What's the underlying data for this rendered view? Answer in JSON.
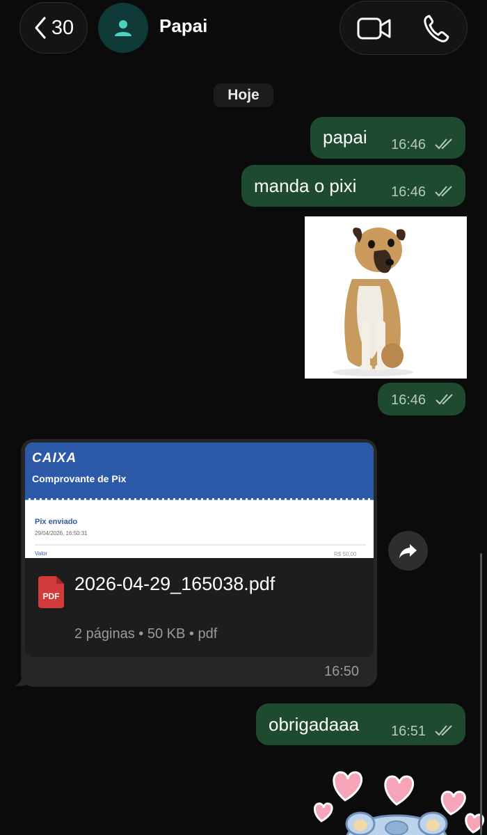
{
  "header": {
    "back_count": "30",
    "contact_name": "Papai",
    "video_call_icon": "video-camera-icon",
    "voice_call_icon": "phone-icon",
    "avatar_icon": "person-icon"
  },
  "date_separator": "Hoje",
  "messages": [
    {
      "type": "outgoing-text",
      "text": "papai",
      "time": "16:46",
      "status": "read"
    },
    {
      "type": "outgoing-text",
      "text": "manda o pixi",
      "time": "16:46",
      "status": "read"
    },
    {
      "type": "outgoing-image",
      "content": "dog photo",
      "time": "16:46",
      "status": "read"
    },
    {
      "type": "incoming-document",
      "preview": {
        "brand": "CAIXA",
        "heading": "Comprovante de Pix",
        "status": "Pix enviado",
        "datetime": "29/04/2026, 16:50:31",
        "amount_label": "Valor",
        "amount": "R$ 50,00"
      },
      "file_icon_label": "PDF",
      "file_name": "2026-04-29_165038.pdf",
      "file_meta": "2 páginas • 50 KB • pdf",
      "time": "16:50"
    },
    {
      "type": "outgoing-text",
      "text": "obrigadaaa",
      "time": "16:51",
      "status": "read"
    },
    {
      "type": "outgoing-sticker",
      "content": "hearts sticker"
    }
  ],
  "colors": {
    "background": "#0b0b0b",
    "outgoing_bubble": "#1e4a30",
    "incoming_bubble": "#262626",
    "avatar_bg": "#0f3a38",
    "avatar_icon": "#4ed0c4",
    "pdf_red": "#d13b3b",
    "caixa_blue": "#2d5aa8"
  }
}
